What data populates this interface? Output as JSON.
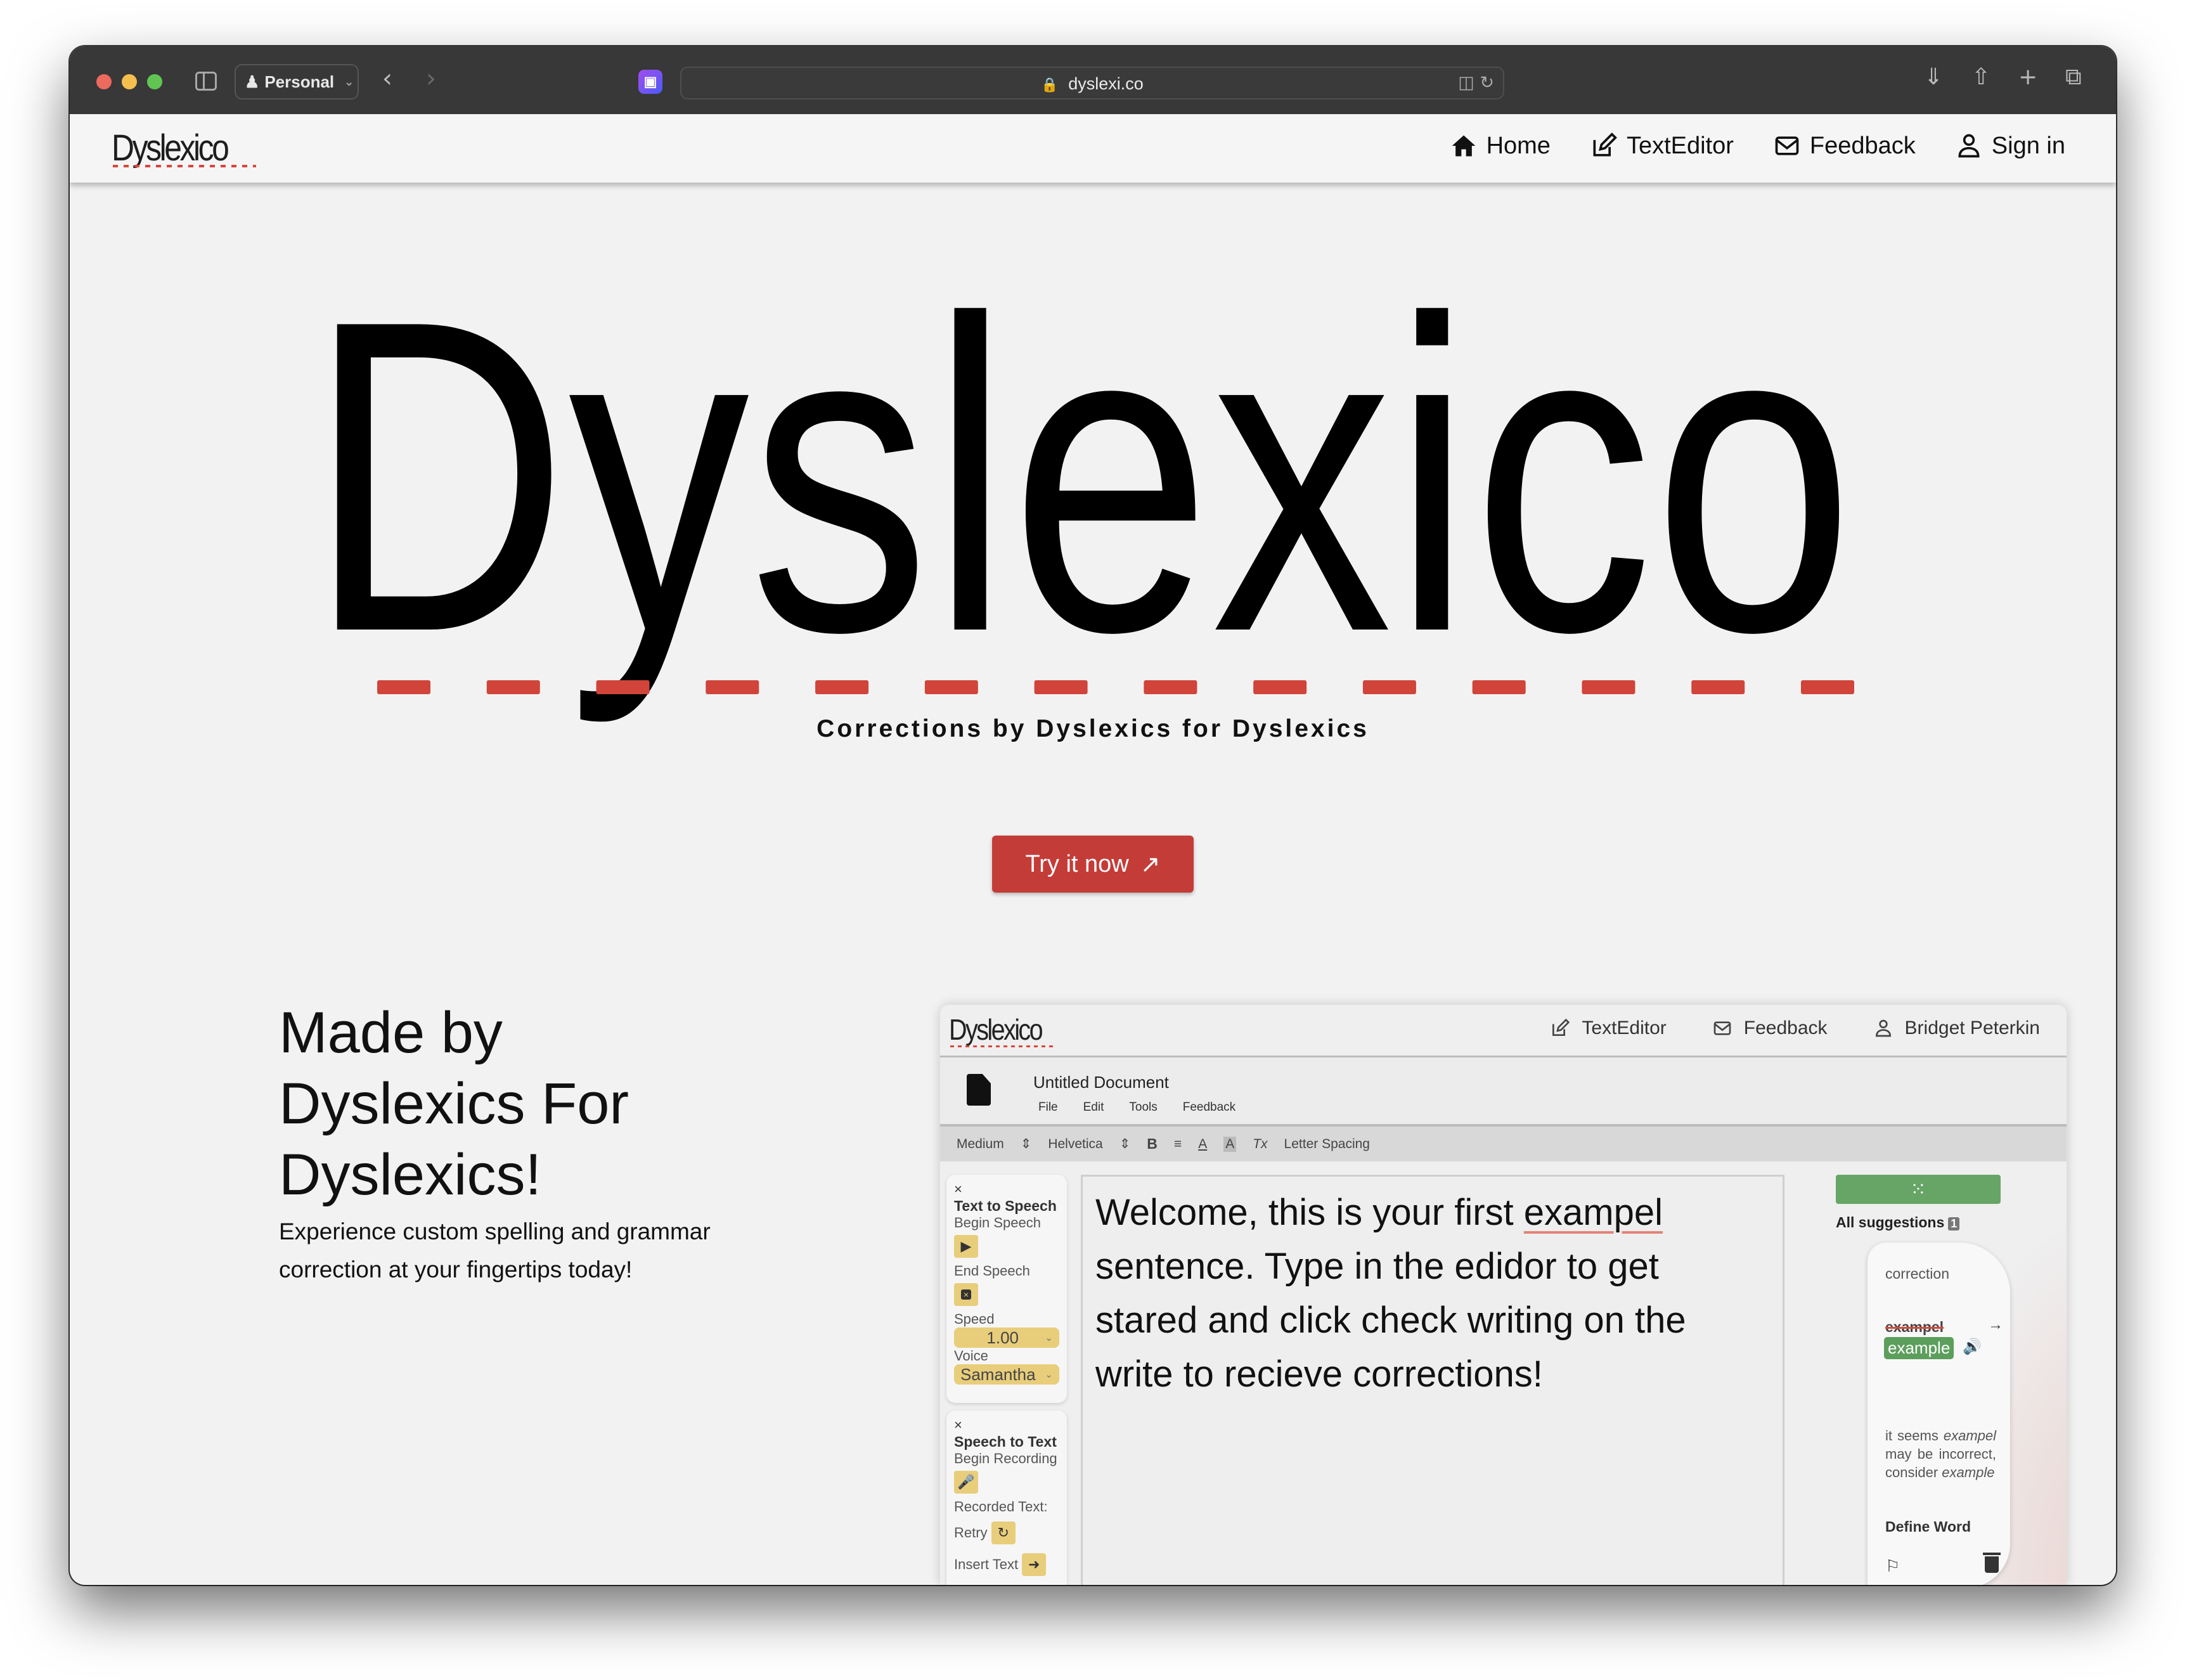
{
  "browser": {
    "profile_label": "Personal",
    "url": "dyslexi.co",
    "icons": [
      "sidebar-icon",
      "person-icon",
      "back-icon",
      "forward-icon",
      "extension-icon",
      "lock-icon",
      "translate-icon",
      "reload-icon",
      "download-icon",
      "share-icon",
      "new-tab-icon",
      "tab-overview-icon"
    ]
  },
  "site_nav": {
    "logo": "Dyslexico",
    "links": [
      {
        "label": "Home",
        "icon": "home-icon"
      },
      {
        "label": "TextEditor",
        "icon": "edit-icon"
      },
      {
        "label": "Feedback",
        "icon": "mail-icon"
      },
      {
        "label": "Sign in",
        "icon": "user-icon"
      }
    ]
  },
  "hero": {
    "logo_text": "Dyslexico",
    "tagline": "Corrections by Dyslexics for Dyslexics",
    "cta_label": "Try it now",
    "cta_icon": "arrow-up-right-icon",
    "accent_color": "#c43c37"
  },
  "feature": {
    "heading": "Made by Dyslexics For Dyslexics!",
    "paragraph": "Experience custom spelling and grammar correction at your fingertips today!"
  },
  "preview": {
    "nav": {
      "logo": "Dyslexico",
      "links": [
        {
          "label": "TextEditor",
          "icon": "edit-icon"
        },
        {
          "label": "Feedback",
          "icon": "mail-icon"
        },
        {
          "label": "Bridget Peterkin",
          "icon": "user-icon"
        }
      ]
    },
    "document": {
      "title": "Untitled Document",
      "menu": [
        "File",
        "Edit",
        "Tools",
        "Feedback"
      ]
    },
    "format_toolbar": {
      "size": "Medium",
      "font": "Helvetica",
      "bold": "B",
      "align": "≡",
      "text_color": "A",
      "highlight": "A",
      "clear": "Tx",
      "letter_spacing": "Letter Spacing"
    },
    "tts_panel": {
      "close": "×",
      "title": "Text to Speech",
      "begin_label": "Begin Speech",
      "end_label": "End Speech",
      "speed_label": "Speed",
      "speed_value": "1.00",
      "voice_label": "Voice",
      "voice_value": "Samantha"
    },
    "stt_panel": {
      "close": "×",
      "title": "Speech to Text",
      "begin_label": "Begin Recording",
      "recorded_label": "Recorded Text:",
      "retry_label": "Retry",
      "insert_label": "Insert Text"
    },
    "editor": {
      "before": "Welcome, this is your first ",
      "error_word": "exampel",
      "after": " sentence. Type in the edidor to get stared and click check writing on the write to recieve corrections!"
    },
    "suggestions": {
      "title": "All suggestions",
      "count": "1",
      "card": {
        "type": "correction",
        "wrong": "exampel",
        "right": "example",
        "description_pre": "it seems ",
        "description_word": "exampel",
        "description_mid": " may be incorrect, consider ",
        "description_suggest": "example",
        "define_label": "Define Word"
      },
      "check_color": "#66a566"
    }
  }
}
